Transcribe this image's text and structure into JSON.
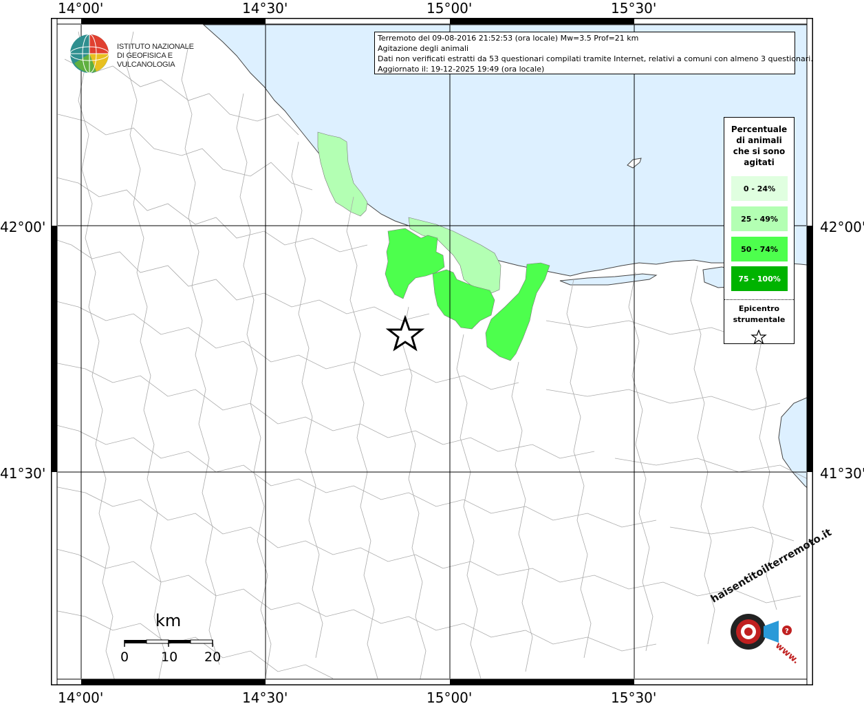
{
  "axes": {
    "top_labels": [
      "14°00'",
      "14°30'",
      "15°00'",
      "15°30'"
    ],
    "bottom_labels": [
      "14°00'",
      "14°30'",
      "15°00'",
      "15°30'"
    ],
    "left_labels": [
      "42°00'",
      "41°30'"
    ],
    "right_labels": [
      "42°00'",
      "41°30'"
    ]
  },
  "info": {
    "line1": "Terremoto del 09-08-2016 21:52:53 (ora locale) Mw=3.5 Prof=21 km",
    "line2": "Agitazione degli animali",
    "line3": "Dati non verificati estratti da 53 questionari compilati tramite Internet, relativi a comuni con almeno 3 questionari.",
    "line4": "Aggiornato il: 19-12-2025 19:49 (ora locale)"
  },
  "legend": {
    "title_l1": "Percentuale",
    "title_l2": "di animali",
    "title_l3": "che si sono",
    "title_l4": "agitati",
    "items": [
      {
        "label": "0 - 24%",
        "color": "#e0ffe0"
      },
      {
        "label": "25 - 49%",
        "color": "#b3ffb3"
      },
      {
        "label": "50 - 74%",
        "color": "#4dff4d"
      },
      {
        "label": "75 - 100%",
        "color": "#00b300"
      }
    ],
    "epi_l1": "Epicentro",
    "epi_l2": "strumentale"
  },
  "logo": {
    "line1": "ISTITUTO NAZIONALE",
    "line2": "DI GEOFISICA E VULCANOLOGIA",
    "hsi_text": "haisentitoilterremoto.it",
    "hsi_www": "www."
  },
  "scale": {
    "unit": "km",
    "ticks": [
      "0",
      "10",
      "20"
    ]
  },
  "colors": {
    "sea": "#ddf0ff",
    "land": "#ffffff",
    "boundary": "#aaaaaa",
    "grid": "#000000"
  }
}
